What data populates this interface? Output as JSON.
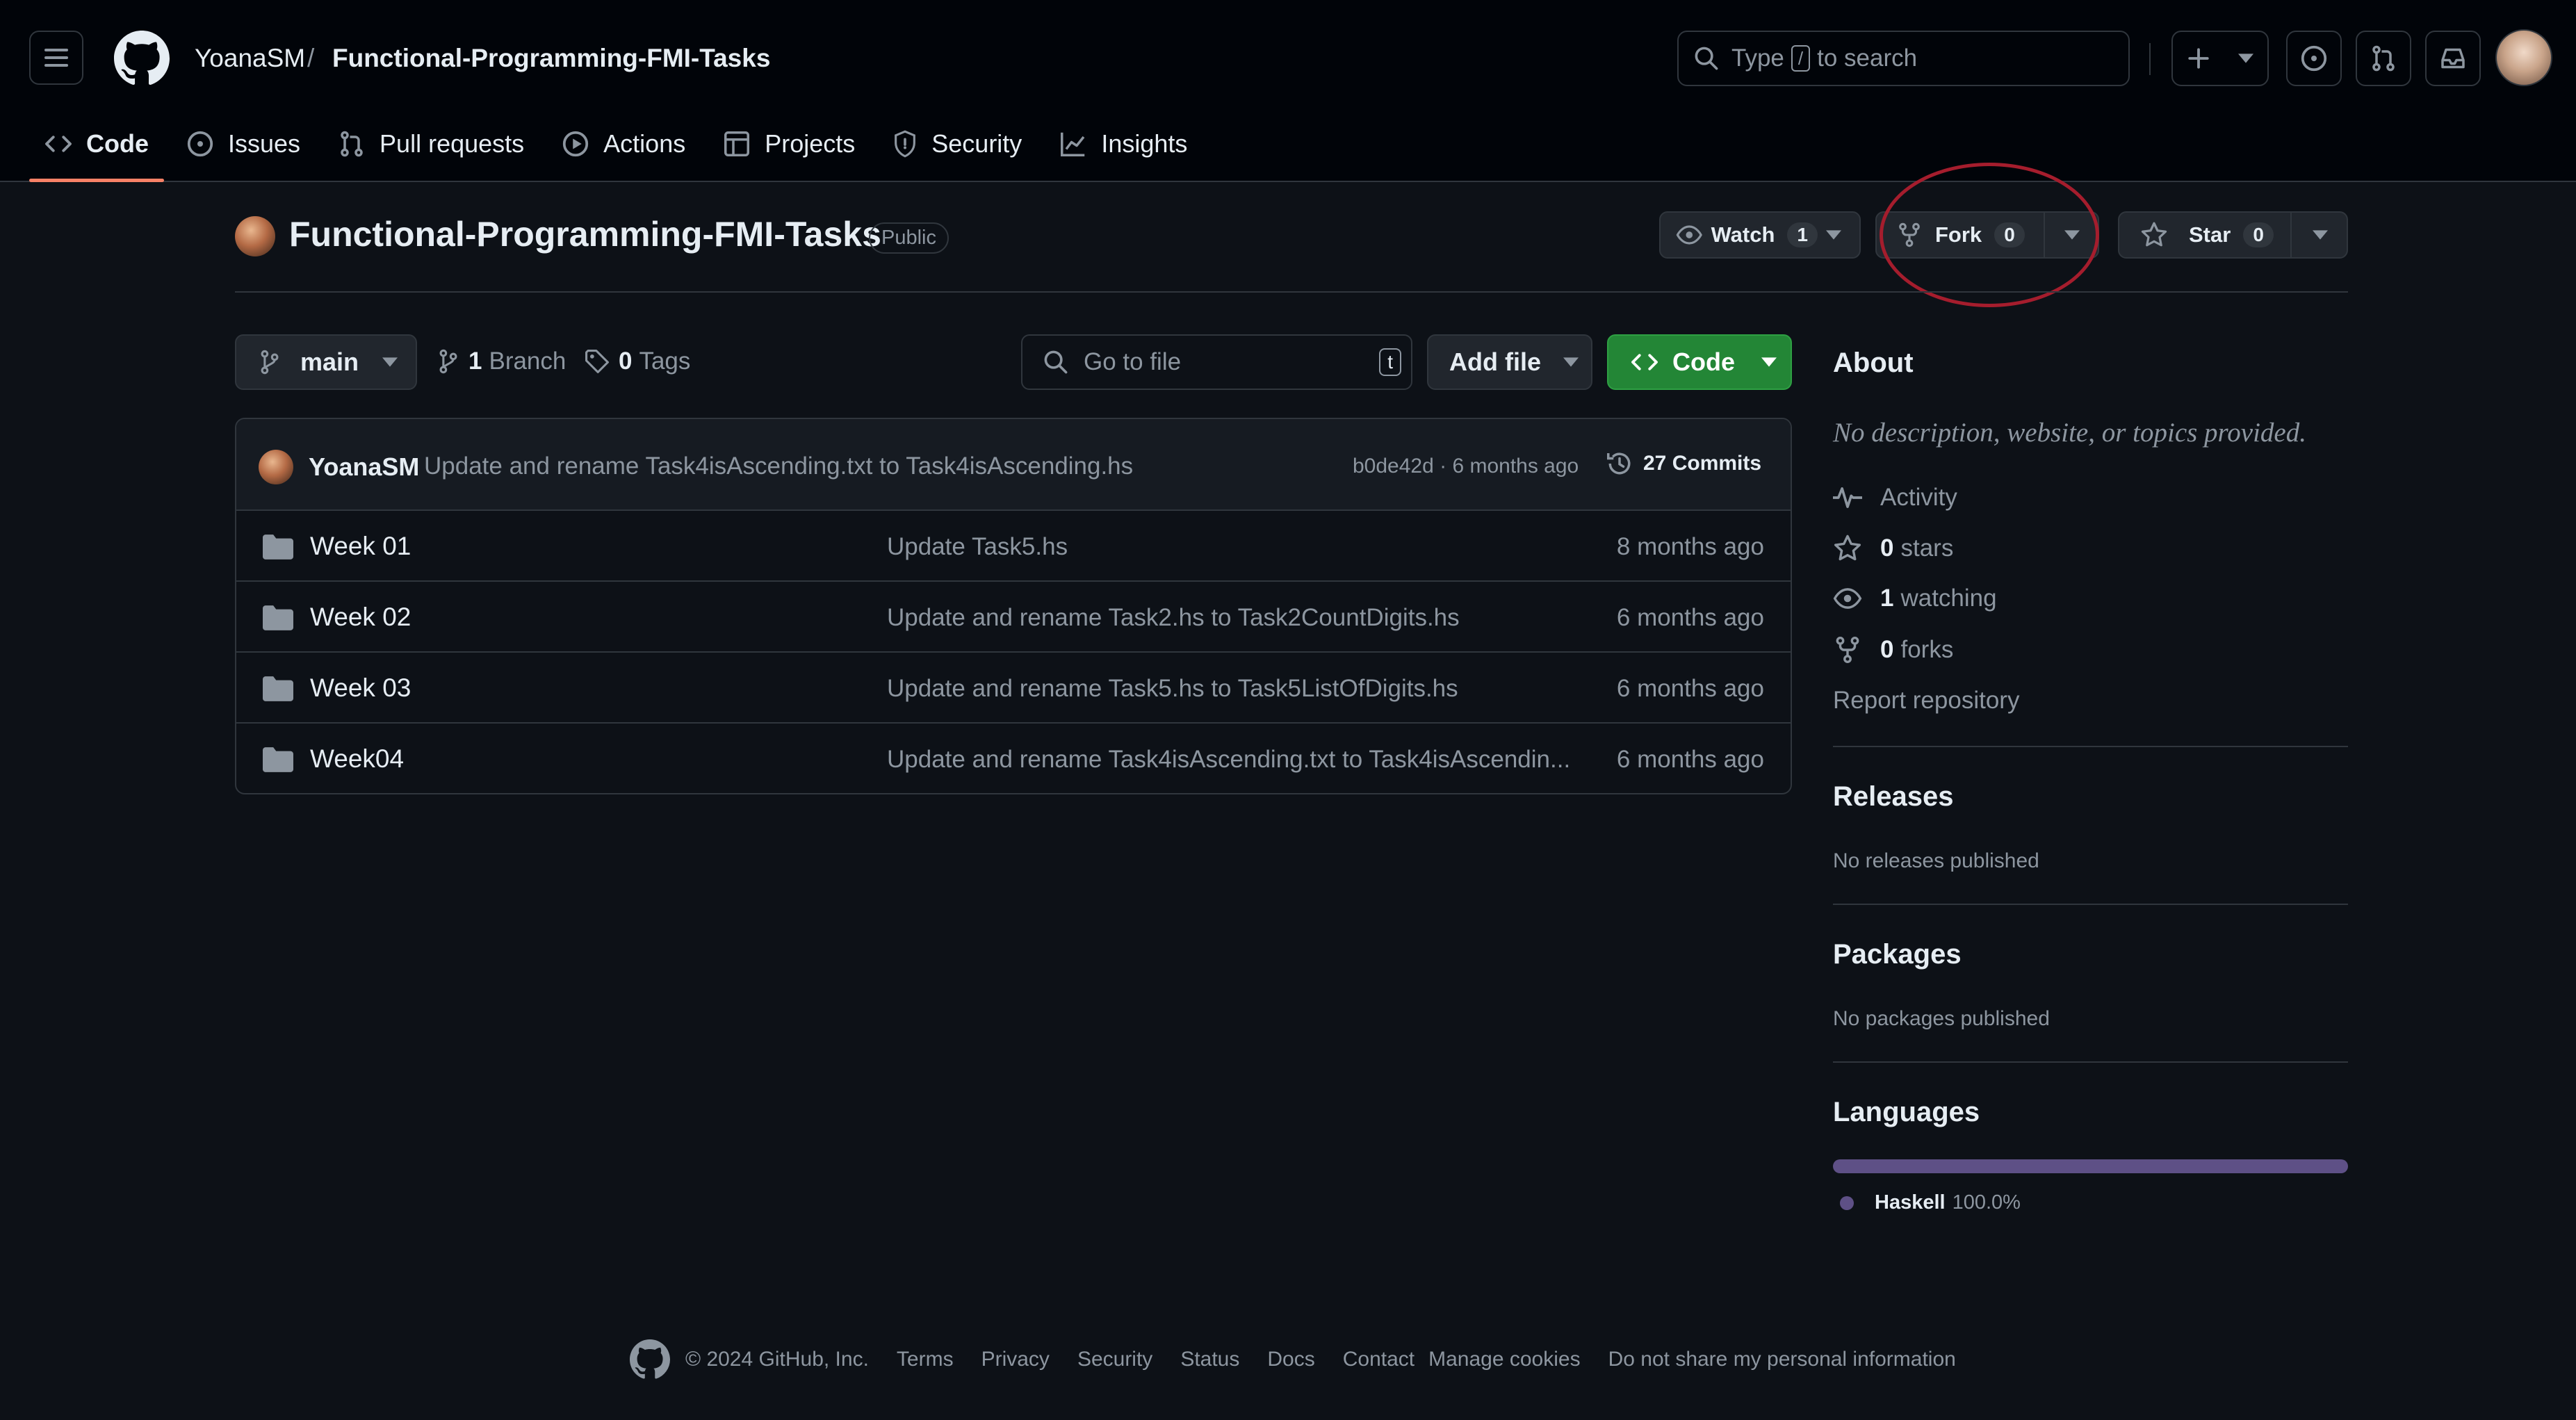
{
  "header": {
    "owner": "YoanaSM",
    "separator": "/",
    "repo": "Functional-Programming-FMI-Tasks",
    "search": {
      "prefix": "Type",
      "key": "/",
      "suffix": "to search"
    }
  },
  "tabs": [
    {
      "label": "Code",
      "icon": "code-icon",
      "active": true
    },
    {
      "label": "Issues",
      "icon": "issue-icon"
    },
    {
      "label": "Pull requests",
      "icon": "pull-request-icon"
    },
    {
      "label": "Actions",
      "icon": "play-icon"
    },
    {
      "label": "Projects",
      "icon": "table-icon"
    },
    {
      "label": "Security",
      "icon": "shield-icon"
    },
    {
      "label": "Insights",
      "icon": "graph-icon"
    }
  ],
  "repo_header": {
    "title": "Functional-Programming-FMI-Tasks",
    "visibility": "Public",
    "watch": {
      "label": "Watch",
      "count": "1"
    },
    "fork": {
      "label": "Fork",
      "count": "0"
    },
    "star": {
      "label": "Star",
      "count": "0"
    }
  },
  "toolbar": {
    "branch": "main",
    "branches": {
      "count": "1",
      "label": "Branch"
    },
    "tags": {
      "count": "0",
      "label": "Tags"
    },
    "goto_placeholder": "Go to file",
    "goto_key": "t",
    "add_file": "Add file",
    "code": "Code"
  },
  "latest_commit": {
    "author": "YoanaSM",
    "message": "Update and rename Task4isAscending.txt to Task4isAscending.hs",
    "meta": "b0de42d · 6 months ago",
    "commits": "27 Commits"
  },
  "files": [
    {
      "name": "Week 01",
      "message": "Update Task5.hs",
      "age": "8 months ago"
    },
    {
      "name": "Week 02",
      "message": "Update and rename Task2.hs to Task2CountDigits.hs",
      "age": "6 months ago"
    },
    {
      "name": "Week 03",
      "message": "Update and rename Task5.hs to Task5ListOfDigits.hs",
      "age": "6 months ago"
    },
    {
      "name": "Week04",
      "message": "Update and rename Task4isAscending.txt to Task4isAscendin...",
      "age": "6 months ago"
    }
  ],
  "about": {
    "heading": "About",
    "description": "No description, website, or topics provided.",
    "activity": "Activity",
    "stars": {
      "count": "0",
      "label": "stars"
    },
    "watching": {
      "count": "1",
      "label": "watching"
    },
    "forks": {
      "count": "0",
      "label": "forks"
    },
    "report": "Report repository"
  },
  "releases": {
    "heading": "Releases",
    "text": "No releases published"
  },
  "packages": {
    "heading": "Packages",
    "text": "No packages published"
  },
  "languages": {
    "heading": "Languages",
    "items": [
      {
        "name": "Haskell",
        "percent": "100.0%",
        "fraction": 1.0,
        "color": "#5e5086"
      }
    ]
  },
  "footer": {
    "copyright": "© 2024 GitHub, Inc.",
    "links": [
      "Terms",
      "Privacy",
      "Security",
      "Status",
      "Docs",
      "Contact",
      "Manage cookies",
      "Do not share my personal information"
    ]
  },
  "colors": {
    "accent_tab": "#f78166",
    "code_button": "#238636",
    "annotation": "#a51d2d"
  }
}
